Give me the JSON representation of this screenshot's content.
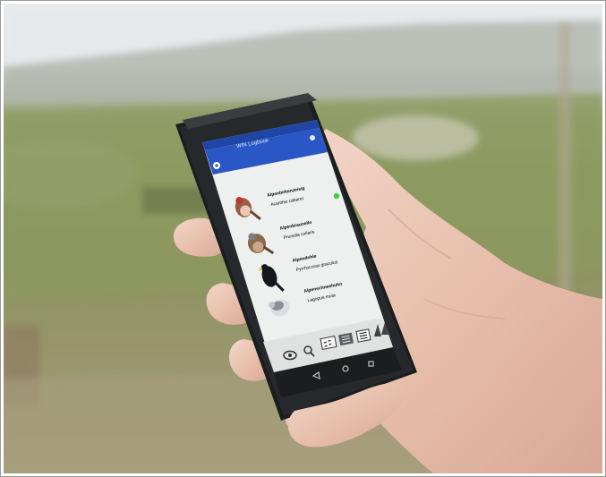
{
  "app": {
    "title": "WIN Logbook",
    "bar_color": "#2a56c6",
    "list_background": "#eef0ef",
    "status_dot_color": "#3bd23b"
  },
  "birds": [
    {
      "name": "Alpenbirkenzeisig",
      "latin": "Acanthis cabaret",
      "icon": "redpoll-bird-icon"
    },
    {
      "name": "Alpenbraunelle",
      "latin": "Prunella collaris",
      "icon": "accentor-bird-icon"
    },
    {
      "name": "Alpendohle",
      "latin": "Pyrrhocorax graculus",
      "icon": "chough-bird-icon"
    },
    {
      "name": "Alpenschneehuhn",
      "latin": "Lagopus muta",
      "icon": "ptarmigan-bird-icon"
    }
  ],
  "toolbar": {
    "icons": [
      "eye-icon",
      "search-icon",
      "grid-view-icon",
      "detail-list-icon",
      "list-view-icon",
      "binoculars-icon"
    ]
  },
  "navbar": {
    "icons": [
      "back-nav-icon",
      "home-nav-icon",
      "recents-nav-icon"
    ]
  }
}
